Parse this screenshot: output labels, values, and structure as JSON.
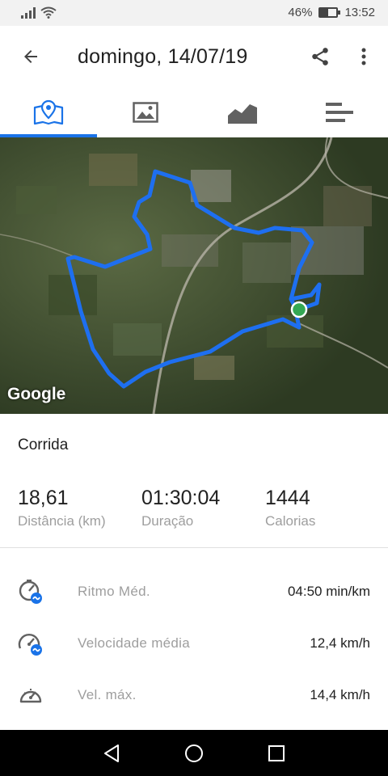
{
  "status_bar": {
    "battery": "46%",
    "time": "13:52",
    "battery_level": 0.46
  },
  "app_bar": {
    "title": "domingo, 14/07/19"
  },
  "tabs": [
    {
      "name": "map",
      "icon": "map-pin-icon",
      "selected": true
    },
    {
      "name": "photos",
      "icon": "image-icon",
      "selected": false
    },
    {
      "name": "charts",
      "icon": "area-chart-icon",
      "selected": false
    },
    {
      "name": "laps",
      "icon": "bars-icon",
      "selected": false
    }
  ],
  "map": {
    "provider": "Google"
  },
  "activity": {
    "type": "Corrida",
    "stats": [
      {
        "value": "18,61",
        "label": "Distância (km)"
      },
      {
        "value": "01:30:04",
        "label": "Duração"
      },
      {
        "value": "1444",
        "label": "Calorias"
      }
    ],
    "metrics": [
      {
        "icon": "pace-icon",
        "label": "Ritmo Méd.",
        "value": "04:50 min/km"
      },
      {
        "icon": "average-speed-icon",
        "label": "Velocidade média",
        "value": "12,4 km/h"
      },
      {
        "icon": "max-speed-icon",
        "label": "Vel. máx.",
        "value": "14,4 km/h"
      }
    ]
  },
  "colors": {
    "accent": "#1a73e8",
    "route": "#1e6ff0",
    "start_marker": "#34a853"
  }
}
